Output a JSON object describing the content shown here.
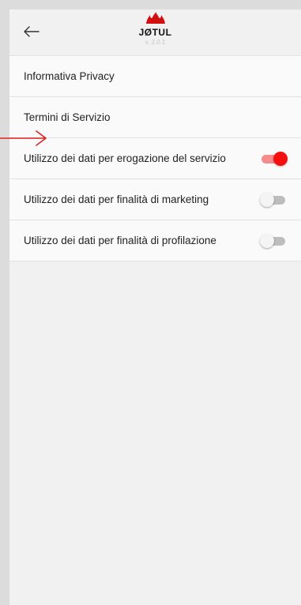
{
  "header": {
    "back_icon": "arrow-left-icon",
    "brand": "JØTUL",
    "version": "v. 2.0.1"
  },
  "list": {
    "items": [
      {
        "label": "Informativa Privacy"
      },
      {
        "label": "Termini di Servizio"
      },
      {
        "label": "Utilizzo dei dati per erogazione del servizio",
        "toggle": true
      },
      {
        "label": "Utilizzo dei dati per finalità di marketing",
        "toggle": false
      },
      {
        "label": "Utilizzo dei dati per finalità di profilazione",
        "toggle": false
      }
    ]
  },
  "colors": {
    "accent": "#f51010",
    "annotation_arrow": "#e02020"
  }
}
